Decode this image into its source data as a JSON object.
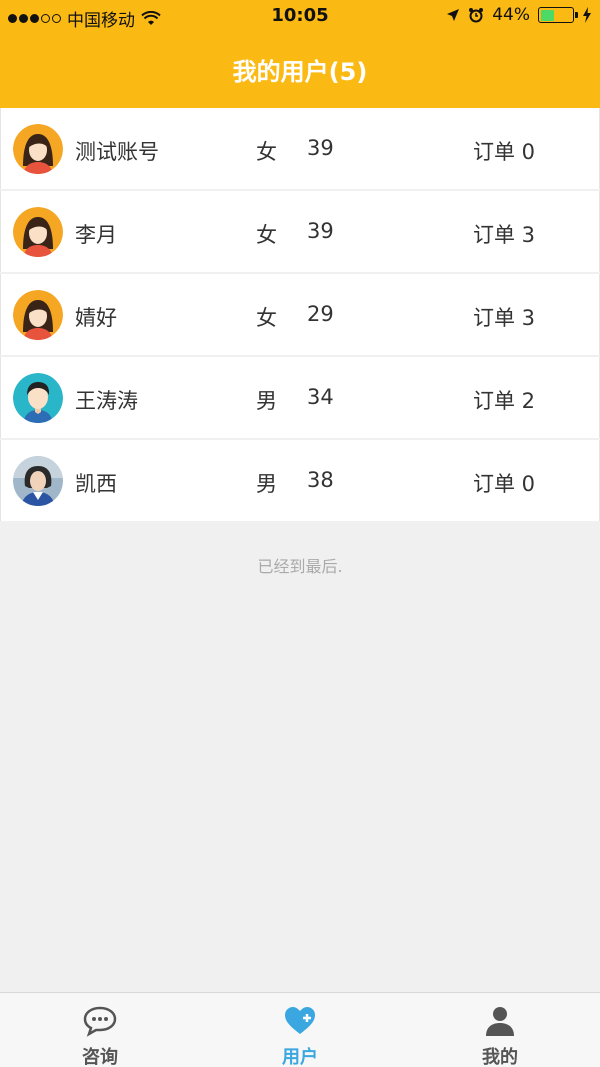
{
  "status_bar": {
    "carrier": "中国移动",
    "time": "10:05",
    "battery": "44%",
    "battery_level": 0.44
  },
  "header": {
    "title": "我的用户(5)"
  },
  "users": [
    {
      "name": "测试账号",
      "gender": "女",
      "age": "39",
      "orders": "订单 0",
      "avatar": "female-avatar-icon"
    },
    {
      "name": "李月",
      "gender": "女",
      "age": "39",
      "orders": "订单 3",
      "avatar": "female-avatar-icon"
    },
    {
      "name": "婧好",
      "gender": "女",
      "age": "29",
      "orders": "订单 3",
      "avatar": "female-avatar-icon"
    },
    {
      "name": "王涛涛",
      "gender": "男",
      "age": "34",
      "orders": "订单 2",
      "avatar": "male-avatar-icon"
    },
    {
      "name": "凯西",
      "gender": "男",
      "age": "38",
      "orders": "订单 0",
      "avatar": "photo-avatar"
    }
  ],
  "list_footer": "已经到最后.",
  "tabbar": {
    "tabs": [
      {
        "label": "咨询",
        "icon": "chat-bubble-icon",
        "active": false
      },
      {
        "label": "用户",
        "icon": "heart-plus-icon",
        "active": true
      },
      {
        "label": "我的",
        "icon": "person-icon",
        "active": false
      }
    ]
  },
  "colors": {
    "header": "#fbb913",
    "active_tab": "#3aa7e0",
    "avatar_female_bg": "#f5a623",
    "avatar_male_bg": "#29b6c9"
  }
}
